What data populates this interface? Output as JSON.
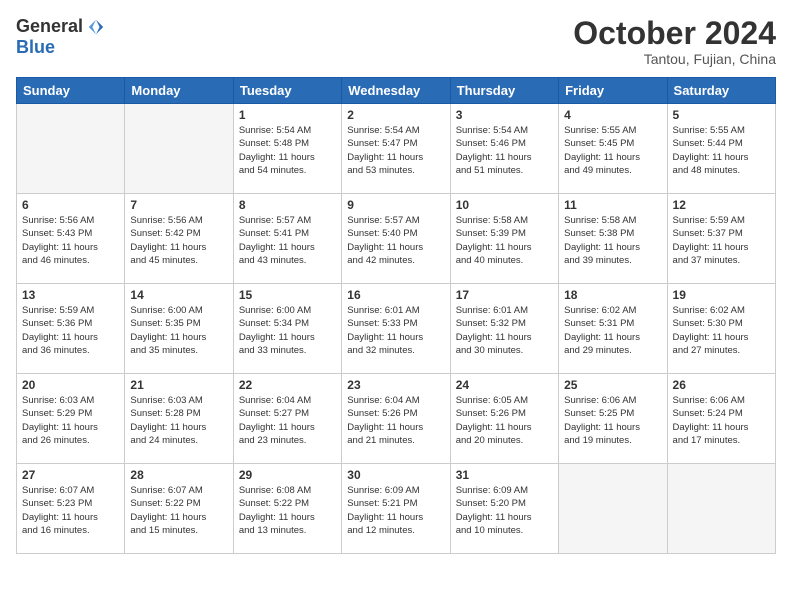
{
  "header": {
    "logo_general": "General",
    "logo_blue": "Blue",
    "month_title": "October 2024",
    "location": "Tantou, Fujian, China"
  },
  "calendar": {
    "days_of_week": [
      "Sunday",
      "Monday",
      "Tuesday",
      "Wednesday",
      "Thursday",
      "Friday",
      "Saturday"
    ],
    "weeks": [
      [
        {
          "day": "",
          "info": ""
        },
        {
          "day": "",
          "info": ""
        },
        {
          "day": "1",
          "info": "Sunrise: 5:54 AM\nSunset: 5:48 PM\nDaylight: 11 hours\nand 54 minutes."
        },
        {
          "day": "2",
          "info": "Sunrise: 5:54 AM\nSunset: 5:47 PM\nDaylight: 11 hours\nand 53 minutes."
        },
        {
          "day": "3",
          "info": "Sunrise: 5:54 AM\nSunset: 5:46 PM\nDaylight: 11 hours\nand 51 minutes."
        },
        {
          "day": "4",
          "info": "Sunrise: 5:55 AM\nSunset: 5:45 PM\nDaylight: 11 hours\nand 49 minutes."
        },
        {
          "day": "5",
          "info": "Sunrise: 5:55 AM\nSunset: 5:44 PM\nDaylight: 11 hours\nand 48 minutes."
        }
      ],
      [
        {
          "day": "6",
          "info": "Sunrise: 5:56 AM\nSunset: 5:43 PM\nDaylight: 11 hours\nand 46 minutes."
        },
        {
          "day": "7",
          "info": "Sunrise: 5:56 AM\nSunset: 5:42 PM\nDaylight: 11 hours\nand 45 minutes."
        },
        {
          "day": "8",
          "info": "Sunrise: 5:57 AM\nSunset: 5:41 PM\nDaylight: 11 hours\nand 43 minutes."
        },
        {
          "day": "9",
          "info": "Sunrise: 5:57 AM\nSunset: 5:40 PM\nDaylight: 11 hours\nand 42 minutes."
        },
        {
          "day": "10",
          "info": "Sunrise: 5:58 AM\nSunset: 5:39 PM\nDaylight: 11 hours\nand 40 minutes."
        },
        {
          "day": "11",
          "info": "Sunrise: 5:58 AM\nSunset: 5:38 PM\nDaylight: 11 hours\nand 39 minutes."
        },
        {
          "day": "12",
          "info": "Sunrise: 5:59 AM\nSunset: 5:37 PM\nDaylight: 11 hours\nand 37 minutes."
        }
      ],
      [
        {
          "day": "13",
          "info": "Sunrise: 5:59 AM\nSunset: 5:36 PM\nDaylight: 11 hours\nand 36 minutes."
        },
        {
          "day": "14",
          "info": "Sunrise: 6:00 AM\nSunset: 5:35 PM\nDaylight: 11 hours\nand 35 minutes."
        },
        {
          "day": "15",
          "info": "Sunrise: 6:00 AM\nSunset: 5:34 PM\nDaylight: 11 hours\nand 33 minutes."
        },
        {
          "day": "16",
          "info": "Sunrise: 6:01 AM\nSunset: 5:33 PM\nDaylight: 11 hours\nand 32 minutes."
        },
        {
          "day": "17",
          "info": "Sunrise: 6:01 AM\nSunset: 5:32 PM\nDaylight: 11 hours\nand 30 minutes."
        },
        {
          "day": "18",
          "info": "Sunrise: 6:02 AM\nSunset: 5:31 PM\nDaylight: 11 hours\nand 29 minutes."
        },
        {
          "day": "19",
          "info": "Sunrise: 6:02 AM\nSunset: 5:30 PM\nDaylight: 11 hours\nand 27 minutes."
        }
      ],
      [
        {
          "day": "20",
          "info": "Sunrise: 6:03 AM\nSunset: 5:29 PM\nDaylight: 11 hours\nand 26 minutes."
        },
        {
          "day": "21",
          "info": "Sunrise: 6:03 AM\nSunset: 5:28 PM\nDaylight: 11 hours\nand 24 minutes."
        },
        {
          "day": "22",
          "info": "Sunrise: 6:04 AM\nSunset: 5:27 PM\nDaylight: 11 hours\nand 23 minutes."
        },
        {
          "day": "23",
          "info": "Sunrise: 6:04 AM\nSunset: 5:26 PM\nDaylight: 11 hours\nand 21 minutes."
        },
        {
          "day": "24",
          "info": "Sunrise: 6:05 AM\nSunset: 5:26 PM\nDaylight: 11 hours\nand 20 minutes."
        },
        {
          "day": "25",
          "info": "Sunrise: 6:06 AM\nSunset: 5:25 PM\nDaylight: 11 hours\nand 19 minutes."
        },
        {
          "day": "26",
          "info": "Sunrise: 6:06 AM\nSunset: 5:24 PM\nDaylight: 11 hours\nand 17 minutes."
        }
      ],
      [
        {
          "day": "27",
          "info": "Sunrise: 6:07 AM\nSunset: 5:23 PM\nDaylight: 11 hours\nand 16 minutes."
        },
        {
          "day": "28",
          "info": "Sunrise: 6:07 AM\nSunset: 5:22 PM\nDaylight: 11 hours\nand 15 minutes."
        },
        {
          "day": "29",
          "info": "Sunrise: 6:08 AM\nSunset: 5:22 PM\nDaylight: 11 hours\nand 13 minutes."
        },
        {
          "day": "30",
          "info": "Sunrise: 6:09 AM\nSunset: 5:21 PM\nDaylight: 11 hours\nand 12 minutes."
        },
        {
          "day": "31",
          "info": "Sunrise: 6:09 AM\nSunset: 5:20 PM\nDaylight: 11 hours\nand 10 minutes."
        },
        {
          "day": "",
          "info": ""
        },
        {
          "day": "",
          "info": ""
        }
      ]
    ]
  }
}
